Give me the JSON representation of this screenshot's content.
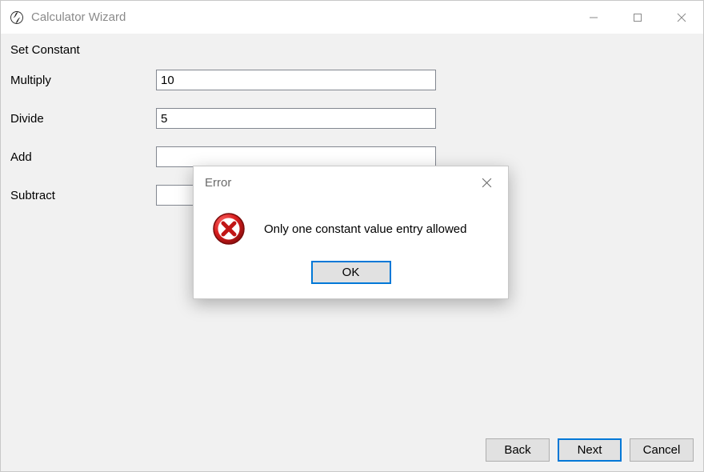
{
  "window": {
    "title": "Calculator Wizard"
  },
  "page": {
    "title": "Set Constant"
  },
  "fields": {
    "multiply": {
      "label": "Multiply",
      "value": "10"
    },
    "divide": {
      "label": "Divide",
      "value": "5"
    },
    "add": {
      "label": "Add",
      "value": ""
    },
    "subtract": {
      "label": "Subtract",
      "value": ""
    }
  },
  "buttons": {
    "back": "Back",
    "next": "Next",
    "cancel": "Cancel"
  },
  "dialog": {
    "title": "Error",
    "message": "Only one constant value entry allowed",
    "ok": "OK"
  }
}
